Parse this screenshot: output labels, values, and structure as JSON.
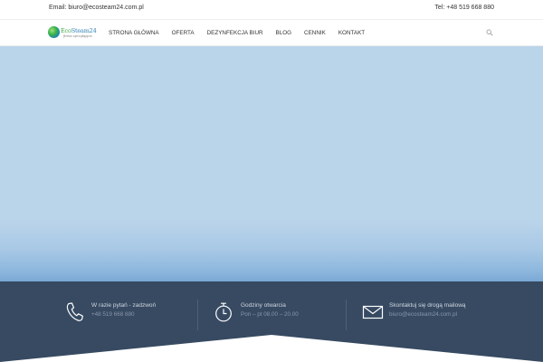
{
  "topbar": {
    "email": "Email: biuro@ecosteam24.com.pl",
    "phone": "Tel: +48 519 668 880"
  },
  "logo": {
    "brand_part1": "Eco",
    "brand_part2": "Steam24",
    "tagline": "firma sprzątająca"
  },
  "nav": {
    "items": [
      {
        "label": "Strona główna"
      },
      {
        "label": "Oferta"
      },
      {
        "label": "Dezynfekcja biur"
      },
      {
        "label": "Blog"
      },
      {
        "label": "Cennik"
      },
      {
        "label": "Kontakt"
      }
    ],
    "search_icon": "search-icon"
  },
  "info": {
    "call": {
      "title": "W razie pytań - zadzwoń",
      "value": "+48 519 668 880",
      "icon": "phone-icon"
    },
    "hours": {
      "title": "Godziny otwarcia",
      "value": "Pon – pt 08.00 – 20.00",
      "icon": "stopwatch-icon"
    },
    "mail": {
      "title": "Skontaktuj się drogą mailową",
      "value": "biuro@ecosteam24.com.pl",
      "icon": "envelope-icon"
    }
  },
  "colors": {
    "hero_sky": "#bad4ea",
    "info_band": "#374a62",
    "brand_blue": "#2d7fb5",
    "brand_green": "#3ea845"
  }
}
